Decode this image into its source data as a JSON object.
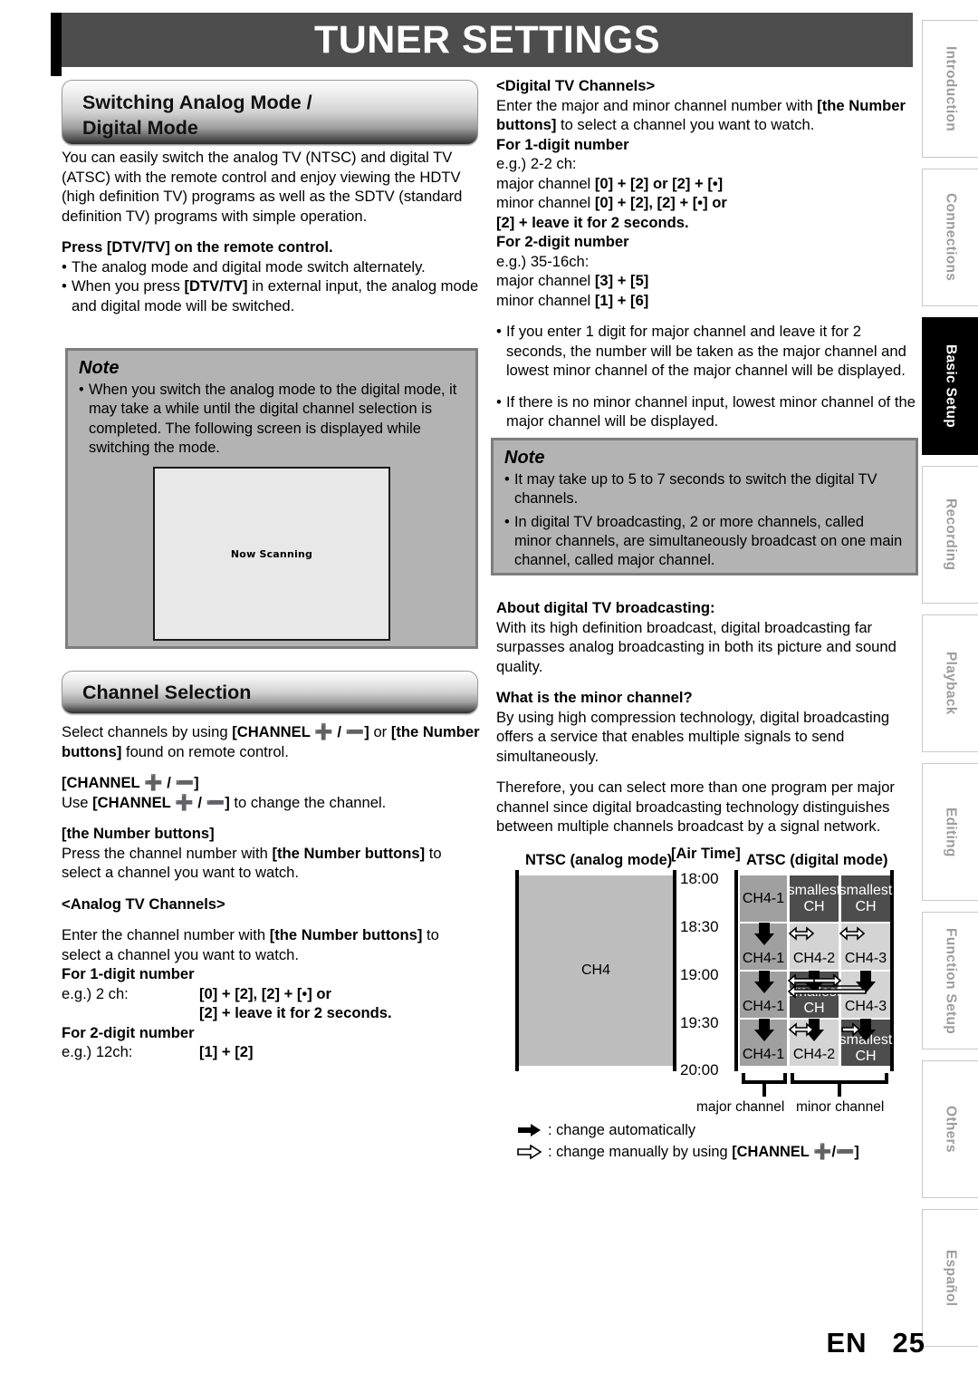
{
  "header": {
    "title": "TUNER SETTINGS"
  },
  "footer": {
    "lang": "EN",
    "page": "25"
  },
  "tabs": [
    {
      "label": "Introduction",
      "active": false
    },
    {
      "label": "Connections",
      "active": false
    },
    {
      "label": "Basic Setup",
      "active": true
    },
    {
      "label": "Recording",
      "active": false
    },
    {
      "label": "Playback",
      "active": false
    },
    {
      "label": "Editing",
      "active": false
    },
    {
      "label": "Function Setup",
      "active": false
    },
    {
      "label": "Others",
      "active": false
    },
    {
      "label": "Español",
      "active": false
    }
  ],
  "left": {
    "banner1_line1": "Switching Analog Mode /",
    "banner1_line2": "Digital Mode",
    "intro": "You can easily switch the analog TV (NTSC) and digital TV (ATSC) with the remote control and enjoy viewing the HDTV (high definition TV) programs as well as the SDTV (standard definition TV) programs with simple operation.",
    "press_heading": "Press [DTV/TV] on the remote control.",
    "bullet1": "The analog mode and digital mode switch alternately.",
    "bullet2_a": "When you press ",
    "bullet2_b": "[DTV/TV]",
    "bullet2_c": " in external input, the analog mode and digital mode will be switched.",
    "note_title": "Note",
    "note_bullet": "When you switch the analog mode to the digital mode, it may take a while until the digital channel selection is completed. The following screen is displayed while switching the mode.",
    "tv_screen_text": "Now Scanning",
    "banner2": "Channel Selection",
    "select_a": "Select channels by using ",
    "select_b": "[CHANNEL ➕ / ➖]",
    "select_c": " or ",
    "select_d": "[the Number buttons]",
    "select_e": " found on remote control.",
    "channel_heading": "[CHANNEL ➕ / ➖]",
    "channel_use_a": "Use ",
    "channel_use_b": "[CHANNEL ➕ / ➖]",
    "channel_use_c": " to change the channel.",
    "numbuttons_heading": "[the Number buttons]",
    "numbuttons_a": "Press the channel number with ",
    "numbuttons_b": "[the Number buttons]",
    "numbuttons_c": " to select a channel you want to watch.",
    "analog_heading": "<Analog TV Channels>",
    "analog_a": "Enter the channel number with ",
    "analog_b": "[the Number buttons]",
    "analog_c": " to select a channel you want to watch.",
    "one_digit_heading": "For 1-digit number",
    "one_digit_eg": "e.g.) 2 ch:",
    "one_digit_val1": "[0] + [2], [2] + [•] or",
    "one_digit_val2": "[2] + leave it for 2 seconds.",
    "two_digit_heading": "For 2-digit number",
    "two_digit_eg": "e.g.) 12ch:",
    "two_digit_val": "[1] + [2]"
  },
  "right": {
    "digital_heading": "<Digital TV Channels>",
    "digital_a": "Enter the major and minor channel number with ",
    "digital_b": "[the Number buttons]",
    "digital_c": " to select a channel you want to watch.",
    "one_digit_heading": "For 1-digit number",
    "one_digit_eg": "e.g.) 2-2 ch:",
    "one_major_key": "major channel",
    "one_major_val": "[0] + [2] or [2] + [•]",
    "one_minor_key": "minor channel",
    "one_minor_val1": "[0] + [2], [2] + [•] or",
    "one_minor_val2": "[2] + leave it for 2 seconds.",
    "two_digit_heading": "For 2-digit number",
    "two_digit_eg": "e.g.) 35-16ch:",
    "two_major_key": "major channel",
    "two_major_val": "[3] + [5]",
    "two_minor_key": "minor channel",
    "two_minor_val": "[1] + [6]",
    "bullet1": "If you enter 1 digit for major channel and leave it for 2 seconds, the number will be taken as the major channel and lowest minor channel of the major channel will be displayed.",
    "bullet2": "If there is no minor channel input, lowest minor channel of the major channel will be displayed.",
    "note_title": "Note",
    "note_bullet1": "It may take up to 5 to 7 seconds to switch the digital TV channels.",
    "note_bullet2": "In digital TV broadcasting, 2 or more channels, called minor channels, are simultaneously broadcast on one main channel, called major channel.",
    "about_heading": "About digital TV broadcasting:",
    "about_body": "With its high definition broadcast, digital broadcasting far surpasses analog broadcasting in both its picture and sound quality.",
    "minor_heading": "What is the minor channel?",
    "minor_body1": "By using high compression technology, digital broadcasting offers a service that enables multiple signals to send simultaneously.",
    "minor_body2": "Therefore, you can select more than one program per major channel since digital broadcasting technology distinguishes between multiple channels broadcast by a signal network."
  },
  "diagram": {
    "ntsc_label": "NTSC (analog mode)",
    "airtime_label": "[Air Time]",
    "atsc_label": "ATSC (digital mode)",
    "ntsc_channel": "CH4",
    "times": [
      "18:00",
      "18:30",
      "19:00",
      "19:30",
      "20:00"
    ],
    "grid": [
      [
        "CH4-1",
        "smallest\nCH",
        "smallest\nCH"
      ],
      [
        "CH4-1",
        "CH4-2",
        "CH4-3"
      ],
      [
        "CH4-1",
        "smallest\nCH",
        "CH4-3"
      ],
      [
        "CH4-1",
        "CH4-2",
        "smallest\nCH"
      ]
    ],
    "major_brace_label": "major channel",
    "minor_brace_label": "minor channel",
    "legend_auto": ": change automatically",
    "legend_manual_a": ": change manually by using ",
    "legend_manual_b": "[CHANNEL ➕/➖]"
  }
}
